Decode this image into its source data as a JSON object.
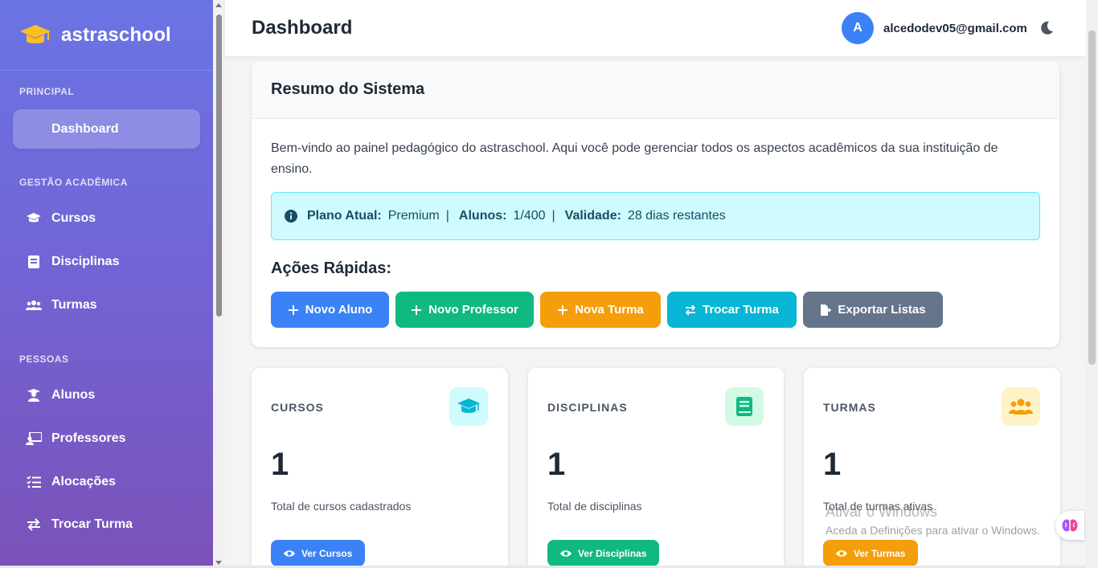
{
  "brand": {
    "name": "astraschool"
  },
  "sidebar": {
    "sections": [
      {
        "title": "PRINCIPAL"
      },
      {
        "title": "GESTÃO ACADÊMICA"
      },
      {
        "title": "PESSOAS"
      }
    ],
    "items": [
      {
        "label": "Dashboard",
        "icon": "dashboard"
      },
      {
        "label": "Cursos",
        "icon": "graduation-cap-icon"
      },
      {
        "label": "Disciplinas",
        "icon": "book-icon"
      },
      {
        "label": "Turmas",
        "icon": "users-icon"
      },
      {
        "label": "Alunos",
        "icon": "student-icon"
      },
      {
        "label": "Professores",
        "icon": "teacher-icon"
      },
      {
        "label": "Alocações",
        "icon": "list-check-icon"
      },
      {
        "label": "Trocar Turma",
        "icon": "exchange-icon"
      }
    ]
  },
  "header": {
    "title": "Dashboard",
    "avatar_initial": "A",
    "email": "alcedodev05@gmail.com"
  },
  "summary": {
    "title": "Resumo do Sistema",
    "welcome": "Bem-vindo ao painel pedagógico do astraschool. Aqui você pode gerenciar todos os aspectos acadêmicos da sua instituição de ensino.",
    "plan_label": "Plano Atual:",
    "plan_value": "Premium",
    "students_label": "Alunos:",
    "students_value": "1/400",
    "validity_label": "Validade:",
    "validity_value": "28 dias restantes",
    "separator": "|",
    "quick_title": "Ações Rápidas:",
    "actions": [
      {
        "label": "Novo Aluno",
        "color": "#3b82f6"
      },
      {
        "label": "Novo Professor",
        "color": "#10b981"
      },
      {
        "label": "Nova Turma",
        "color": "#f59e0b"
      },
      {
        "label": "Trocar Turma",
        "color": "#06b6d4"
      },
      {
        "label": "Exportar Listas",
        "color": "#64748b"
      }
    ]
  },
  "stats": [
    {
      "label": "CURSOS",
      "value": "1",
      "desc": "Total de cursos cadastrados",
      "button": "Ver Cursos",
      "color": "#3b82f6",
      "icon_bg": "#cffafe",
      "icon_color": "#06b6d4"
    },
    {
      "label": "DISCIPLINAS",
      "value": "1",
      "desc": "Total de disciplinas",
      "button": "Ver Disciplinas",
      "color": "#10b981",
      "icon_bg": "#d1fae5",
      "icon_color": "#10b981"
    },
    {
      "label": "TURMAS",
      "value": "1",
      "desc": "Total de turmas ativas",
      "button": "Ver Turmas",
      "color": "#f59e0b",
      "icon_bg": "#fef3c7",
      "icon_color": "#f59e0b"
    }
  ],
  "watermark": {
    "line1": "Ativar o Windows",
    "line2": "Aceda a Definições para ativar o Windows."
  }
}
